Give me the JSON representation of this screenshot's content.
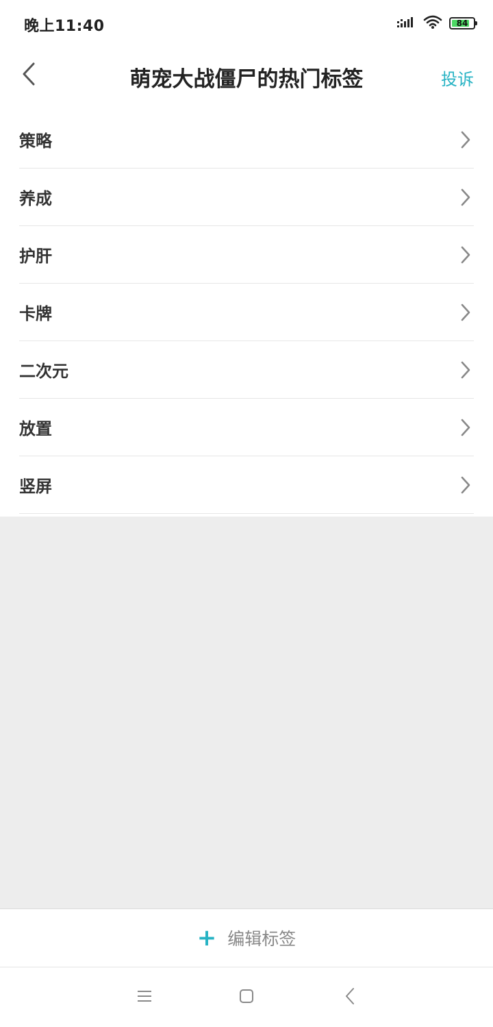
{
  "status_bar": {
    "time": "晚上11:40",
    "battery_level": "84",
    "icons": [
      "signal-icon",
      "wifi-icon",
      "battery-icon"
    ]
  },
  "header": {
    "back_icon": "chevron-left-icon",
    "title": "萌宠大战僵尸的热门标签",
    "report_label": "投诉"
  },
  "tags": [
    {
      "label": "策略"
    },
    {
      "label": "养成"
    },
    {
      "label": "护肝"
    },
    {
      "label": "卡牌"
    },
    {
      "label": "二次元"
    },
    {
      "label": "放置"
    },
    {
      "label": "竖屏"
    }
  ],
  "bottom_action": {
    "icon": "plus-icon",
    "label": "编辑标签"
  },
  "system_nav": {
    "icons": [
      "menu-icon",
      "home-icon",
      "back-icon"
    ]
  },
  "colors": {
    "accent": "#27b3c4",
    "background": "#ededed",
    "surface": "#ffffff",
    "battery_fill": "#4cd964"
  }
}
